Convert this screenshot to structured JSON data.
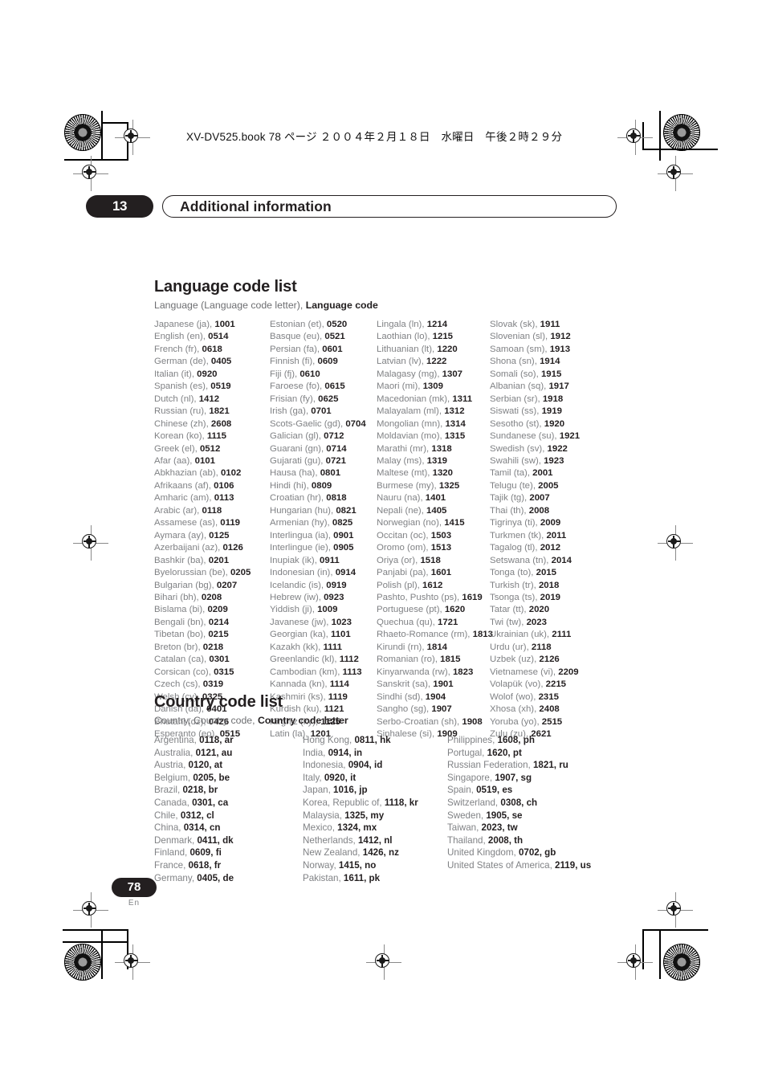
{
  "print_marks": {
    "file_header": "XV-DV525.book  78 ページ  ２００４年２月１８日　水曜日　午後２時２９分"
  },
  "chapter": {
    "number": "13",
    "title": "Additional information"
  },
  "language_section": {
    "title": "Language code list",
    "legend_plain": "Language (Language code letter), ",
    "legend_bold": "Language code",
    "columns": [
      [
        {
          "name": "Japanese (ja), ",
          "code": "1001"
        },
        {
          "name": "English (en), ",
          "code": "0514"
        },
        {
          "name": "French (fr), ",
          "code": "0618"
        },
        {
          "name": "German (de), ",
          "code": "0405"
        },
        {
          "name": "Italian (it), ",
          "code": "0920"
        },
        {
          "name": "Spanish (es), ",
          "code": "0519"
        },
        {
          "name": "Dutch (nl), ",
          "code": "1412"
        },
        {
          "name": "Russian (ru), ",
          "code": "1821"
        },
        {
          "name": "Chinese (zh), ",
          "code": "2608"
        },
        {
          "name": "Korean (ko), ",
          "code": "1115"
        },
        {
          "name": "Greek (el), ",
          "code": "0512"
        },
        {
          "name": "Afar (aa), ",
          "code": "0101"
        },
        {
          "name": "Abkhazian (ab), ",
          "code": "0102"
        },
        {
          "name": "Afrikaans (af), ",
          "code": "0106"
        },
        {
          "name": "Amharic (am), ",
          "code": "0113"
        },
        {
          "name": "Arabic (ar), ",
          "code": "0118"
        },
        {
          "name": "Assamese (as), ",
          "code": "0119"
        },
        {
          "name": "Aymara (ay), ",
          "code": "0125"
        },
        {
          "name": "Azerbaijani (az), ",
          "code": "0126"
        },
        {
          "name": "Bashkir (ba), ",
          "code": "0201"
        },
        {
          "name": "Byelorussian (be), ",
          "code": "0205"
        },
        {
          "name": "Bulgarian (bg), ",
          "code": "0207"
        },
        {
          "name": "Bihari (bh), ",
          "code": "0208"
        },
        {
          "name": "Bislama (bi), ",
          "code": "0209"
        },
        {
          "name": "Bengali (bn), ",
          "code": "0214"
        },
        {
          "name": "Tibetan (bo), ",
          "code": "0215"
        },
        {
          "name": "Breton (br), ",
          "code": "0218"
        },
        {
          "name": "Catalan (ca), ",
          "code": "0301"
        },
        {
          "name": "Corsican (co), ",
          "code": "0315"
        },
        {
          "name": "Czech (cs), ",
          "code": "0319"
        },
        {
          "name": "Welsh (cy), ",
          "code": "0325"
        },
        {
          "name": "Danish (da), ",
          "code": "0401"
        },
        {
          "name": "Bhutani (dz), ",
          "code": "0426"
        },
        {
          "name": "Esperanto (eo), ",
          "code": "0515"
        }
      ],
      [
        {
          "name": "Estonian (et), ",
          "code": "0520"
        },
        {
          "name": "Basque (eu), ",
          "code": "0521"
        },
        {
          "name": "Persian (fa), ",
          "code": "0601"
        },
        {
          "name": "Finnish (fi), ",
          "code": "0609"
        },
        {
          "name": "Fiji (fj), ",
          "code": "0610"
        },
        {
          "name": "Faroese (fo), ",
          "code": "0615"
        },
        {
          "name": "Frisian (fy), ",
          "code": "0625"
        },
        {
          "name": "Irish (ga), ",
          "code": "0701"
        },
        {
          "name": "Scots-Gaelic (gd), ",
          "code": "0704"
        },
        {
          "name": "Galician (gl), ",
          "code": "0712"
        },
        {
          "name": "Guarani (gn), ",
          "code": "0714"
        },
        {
          "name": "Gujarati (gu), ",
          "code": "0721"
        },
        {
          "name": "Hausa (ha), ",
          "code": "0801"
        },
        {
          "name": "Hindi (hi), ",
          "code": "0809"
        },
        {
          "name": "Croatian (hr), ",
          "code": "0818"
        },
        {
          "name": "Hungarian (hu), ",
          "code": "0821"
        },
        {
          "name": "Armenian (hy), ",
          "code": "0825"
        },
        {
          "name": "Interlingua (ia), ",
          "code": "0901"
        },
        {
          "name": "Interlingue (ie), ",
          "code": "0905"
        },
        {
          "name": "Inupiak (ik), ",
          "code": "0911"
        },
        {
          "name": "Indonesian (in), ",
          "code": "0914"
        },
        {
          "name": "Icelandic (is), ",
          "code": "0919"
        },
        {
          "name": "Hebrew (iw), ",
          "code": "0923"
        },
        {
          "name": "Yiddish (ji), ",
          "code": "1009"
        },
        {
          "name": "Javanese (jw), ",
          "code": "1023"
        },
        {
          "name": "Georgian (ka), ",
          "code": "1101"
        },
        {
          "name": "Kazakh (kk), ",
          "code": "1111"
        },
        {
          "name": "Greenlandic  (kl), ",
          "code": "1112"
        },
        {
          "name": "Cambodian (km), ",
          "code": "1113"
        },
        {
          "name": "Kannada (kn), ",
          "code": "1114"
        },
        {
          "name": "Kashmiri (ks), ",
          "code": "1119"
        },
        {
          "name": "Kurdish (ku), ",
          "code": "1121"
        },
        {
          "name": "Kirghiz (ky), ",
          "code": "1125"
        },
        {
          "name": "Latin (la), ",
          "code": "1201"
        }
      ],
      [
        {
          "name": "Lingala (ln), ",
          "code": "1214"
        },
        {
          "name": "Laothian (lo), ",
          "code": "1215"
        },
        {
          "name": "Lithuanian (lt), ",
          "code": "1220"
        },
        {
          "name": "Latvian (lv), ",
          "code": "1222"
        },
        {
          "name": "Malagasy (mg), ",
          "code": "1307"
        },
        {
          "name": "Maori (mi), ",
          "code": "1309"
        },
        {
          "name": "Macedonian (mk), ",
          "code": "1311"
        },
        {
          "name": "Malayalam  (ml), ",
          "code": "1312"
        },
        {
          "name": "Mongolian (mn), ",
          "code": "1314"
        },
        {
          "name": "Moldavian (mo), ",
          "code": "1315"
        },
        {
          "name": "Marathi (mr), ",
          "code": "1318"
        },
        {
          "name": "Malay  (ms), ",
          "code": "1319"
        },
        {
          "name": "Maltese (mt), ",
          "code": "1320"
        },
        {
          "name": "Burmese (my), ",
          "code": "1325"
        },
        {
          "name": "Nauru (na), ",
          "code": "1401"
        },
        {
          "name": "Nepali (ne), ",
          "code": "1405"
        },
        {
          "name": "Norwegian (no), ",
          "code": "1415"
        },
        {
          "name": "Occitan (oc), ",
          "code": "1503"
        },
        {
          "name": "Oromo (om), ",
          "code": "1513"
        },
        {
          "name": "Oriya (or), ",
          "code": "1518"
        },
        {
          "name": "Panjabi (pa), ",
          "code": "1601"
        },
        {
          "name": "Polish (pl), ",
          "code": "1612"
        },
        {
          "name": "Pashto, Pushto (ps), ",
          "code": "1619"
        },
        {
          "name": "Portuguese (pt), ",
          "code": "1620"
        },
        {
          "name": "Quechua (qu), ",
          "code": "1721"
        },
        {
          "name": "Rhaeto-Romance (rm), ",
          "code": "1813"
        },
        {
          "name": "Kirundi (rn), ",
          "code": "1814"
        },
        {
          "name": "Romanian (ro), ",
          "code": "1815"
        },
        {
          "name": "Kinyarwanda (rw), ",
          "code": "1823"
        },
        {
          "name": "Sanskrit (sa), ",
          "code": "1901"
        },
        {
          "name": "Sindhi (sd), ",
          "code": "1904"
        },
        {
          "name": "Sangho (sg), ",
          "code": "1907"
        },
        {
          "name": "Serbo-Croatian (sh), ",
          "code": "1908"
        },
        {
          "name": "Sinhalese (si), ",
          "code": "1909"
        }
      ],
      [
        {
          "name": "Slovak (sk), ",
          "code": "1911"
        },
        {
          "name": "Slovenian (sl), ",
          "code": "1912"
        },
        {
          "name": "Samoan (sm), ",
          "code": "1913"
        },
        {
          "name": "Shona (sn), ",
          "code": "1914"
        },
        {
          "name": "Somali (so), ",
          "code": "1915"
        },
        {
          "name": "Albanian (sq), ",
          "code": "1917"
        },
        {
          "name": "Serbian (sr), ",
          "code": "1918"
        },
        {
          "name": "Siswati (ss), ",
          "code": "1919"
        },
        {
          "name": "Sesotho (st), ",
          "code": "1920"
        },
        {
          "name": "Sundanese (su), ",
          "code": "1921"
        },
        {
          "name": "Swedish (sv), ",
          "code": "1922"
        },
        {
          "name": "Swahili (sw), ",
          "code": "1923"
        },
        {
          "name": "Tamil (ta), ",
          "code": "2001"
        },
        {
          "name": "Telugu (te), ",
          "code": "2005"
        },
        {
          "name": "Tajik (tg), ",
          "code": "2007"
        },
        {
          "name": "Thai (th), ",
          "code": "2008"
        },
        {
          "name": "Tigrinya (ti), ",
          "code": "2009"
        },
        {
          "name": "Turkmen (tk), ",
          "code": "2011"
        },
        {
          "name": "Tagalog (tl), ",
          "code": "2012"
        },
        {
          "name": "Setswana (tn), ",
          "code": "2014"
        },
        {
          "name": "Tonga (to), ",
          "code": "2015"
        },
        {
          "name": "Turkish (tr), ",
          "code": "2018"
        },
        {
          "name": "Tsonga (ts), ",
          "code": "2019"
        },
        {
          "name": "Tatar (tt), ",
          "code": "2020"
        },
        {
          "name": "Twi (tw), ",
          "code": "2023"
        },
        {
          "name": "Ukrainian (uk), ",
          "code": "2111"
        },
        {
          "name": "Urdu (ur), ",
          "code": "2118"
        },
        {
          "name": "Uzbek (uz), ",
          "code": "2126"
        },
        {
          "name": "Vietnamese (vi), ",
          "code": "2209"
        },
        {
          "name": "Volapük (vo), ",
          "code": "2215"
        },
        {
          "name": "Wolof (wo), ",
          "code": "2315"
        },
        {
          "name": "Xhosa (xh), ",
          "code": "2408"
        },
        {
          "name": "Yoruba (yo), ",
          "code": "2515"
        },
        {
          "name": "Zulu (zu), ",
          "code": "2621"
        }
      ]
    ]
  },
  "country_section": {
    "title": "Country code list",
    "legend_plain": "Country, Country code, ",
    "legend_bold": "Country code letter",
    "columns": [
      [
        {
          "name": "Argentina, ",
          "code": "0118, ar"
        },
        {
          "name": "Australia, ",
          "code": "0121, au"
        },
        {
          "name": "Austria, ",
          "code": "0120, at"
        },
        {
          "name": "Belgium, ",
          "code": "0205, be"
        },
        {
          "name": "Brazil, ",
          "code": "0218, br"
        },
        {
          "name": "Canada, ",
          "code": "0301, ca"
        },
        {
          "name": "Chile, ",
          "code": "0312, cl"
        },
        {
          "name": "China, ",
          "code": "0314, cn"
        },
        {
          "name": "Denmark, ",
          "code": "0411, dk"
        },
        {
          "name": "Finland, ",
          "code": "0609, fi"
        },
        {
          "name": "France, ",
          "code": "0618, fr"
        },
        {
          "name": "Germany, ",
          "code": "0405, de"
        }
      ],
      [
        {
          "name": "Hong Kong, ",
          "code": "0811, hk"
        },
        {
          "name": "India, ",
          "code": "0914, in"
        },
        {
          "name": "Indonesia, ",
          "code": "0904, id"
        },
        {
          "name": "Italy, ",
          "code": "0920, it"
        },
        {
          "name": "Japan, ",
          "code": "1016, jp"
        },
        {
          "name": "Korea, Republic of, ",
          "code": "1118, kr"
        },
        {
          "name": "Malaysia, ",
          "code": "1325, my"
        },
        {
          "name": "Mexico, ",
          "code": "1324, mx"
        },
        {
          "name": "Netherlands, ",
          "code": "1412, nl"
        },
        {
          "name": "New Zealand, ",
          "code": "1426, nz"
        },
        {
          "name": "Norway, ",
          "code": "1415, no"
        },
        {
          "name": "Pakistan, ",
          "code": "1611, pk"
        }
      ],
      [
        {
          "name": "Philippines, ",
          "code": "1608, ph"
        },
        {
          "name": "Portugal, ",
          "code": "1620, pt"
        },
        {
          "name": "Russian Federation, ",
          "code": "1821, ru"
        },
        {
          "name": "Singapore, ",
          "code": "1907, sg"
        },
        {
          "name": "Spain, ",
          "code": "0519, es"
        },
        {
          "name": "Switzerland, ",
          "code": "0308, ch"
        },
        {
          "name": "Sweden, ",
          "code": "1905, se"
        },
        {
          "name": "Taiwan, ",
          "code": "2023, tw"
        },
        {
          "name": "Thailand, ",
          "code": "2008, th"
        },
        {
          "name": "United Kingdom, ",
          "code": "0702, gb"
        },
        {
          "name": "United States of America, ",
          "code": "2119, us"
        }
      ]
    ]
  },
  "footer": {
    "page_number": "78",
    "language_tag": "En"
  }
}
